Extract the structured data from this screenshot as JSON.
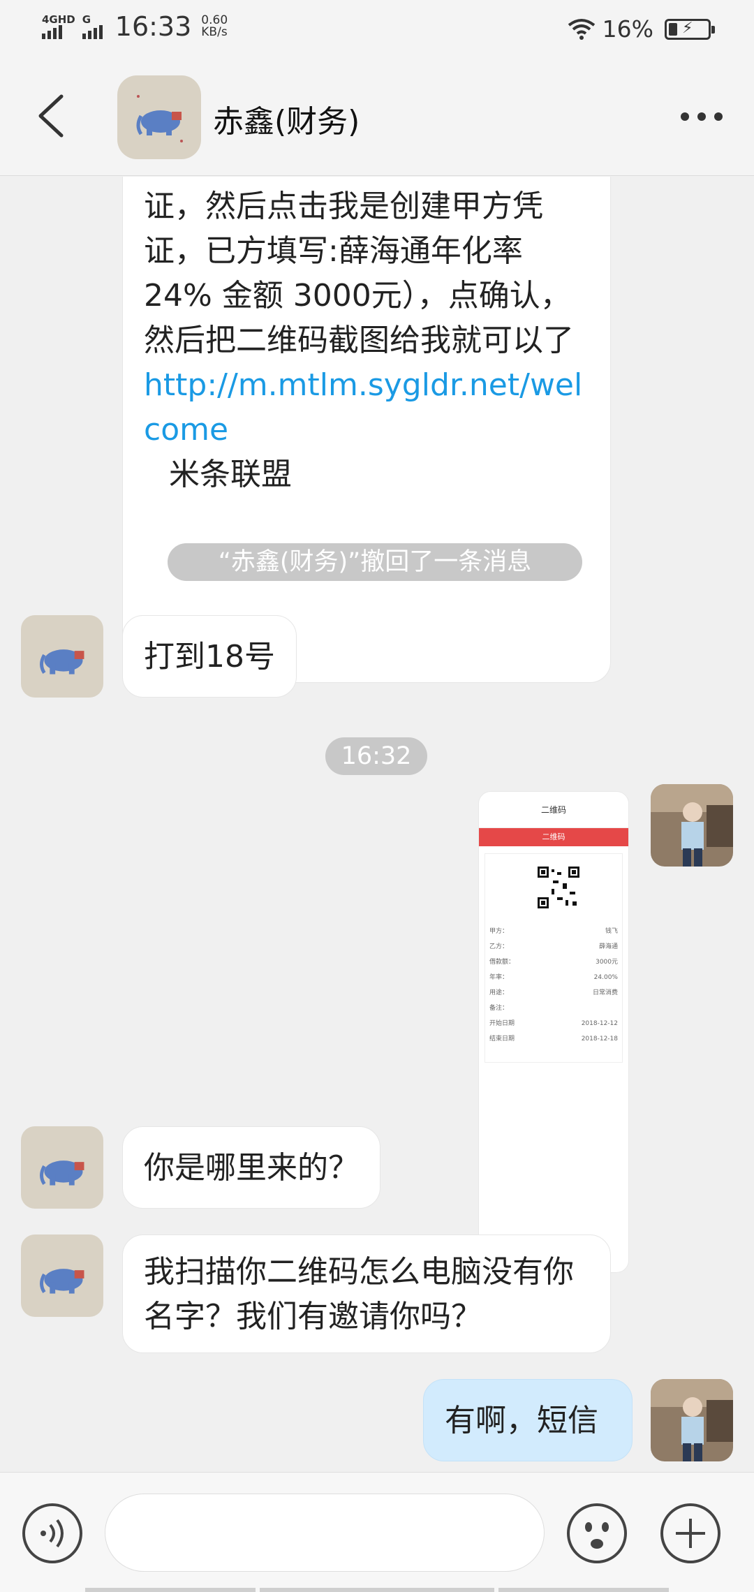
{
  "status_bar": {
    "network": "4GHD",
    "network2": "G",
    "time": "16:33",
    "speed_value": "0.60",
    "speed_unit": "KB/s",
    "battery_percent": "16%",
    "charging": true
  },
  "header": {
    "title": "赤鑫(财务)",
    "back_icon": "chevron-left-icon",
    "more_icon": "more-dots-icon"
  },
  "messages": {
    "long_text": "证，然后点击我是创建甲方凭证，已方填写:薛海通年化率 24% 金额 3000元），点确认，然后把二维码截图给我就可以了",
    "link": "http://m.mtlm.sygldr.net/welcome",
    "signature": "米条联盟",
    "recall_notice": "“赤鑫(财务)”撤回了一条消息",
    "msg_18": "打到18号",
    "time_divider": "16:32",
    "image_screenshot": {
      "title": "二维码",
      "banner": "二维码",
      "rows": [
        {
          "k": "甲方：",
          "v": "钱飞"
        },
        {
          "k": "乙方：",
          "v": "薛海通"
        },
        {
          "k": "借款额：",
          "v": "3000元"
        },
        {
          "k": "年率：",
          "v": "24.00%"
        },
        {
          "k": "用途：",
          "v": "日常消费"
        },
        {
          "k": "备注：",
          "v": ""
        },
        {
          "k": "开始日期",
          "v": "2018-12-12"
        },
        {
          "k": "结束日期",
          "v": "2018-12-18"
        }
      ]
    },
    "msg_where_from": "你是哪里来的？",
    "msg_scan": "我扫描你二维码怎么电脑没有你名字？我们有邀请你吗？",
    "msg_reply": "有啊，短信"
  },
  "input_bar": {
    "placeholder": "",
    "voice_icon": "voice-icon",
    "emoji_icon": "emoji-icon",
    "plus_icon": "plus-icon"
  }
}
